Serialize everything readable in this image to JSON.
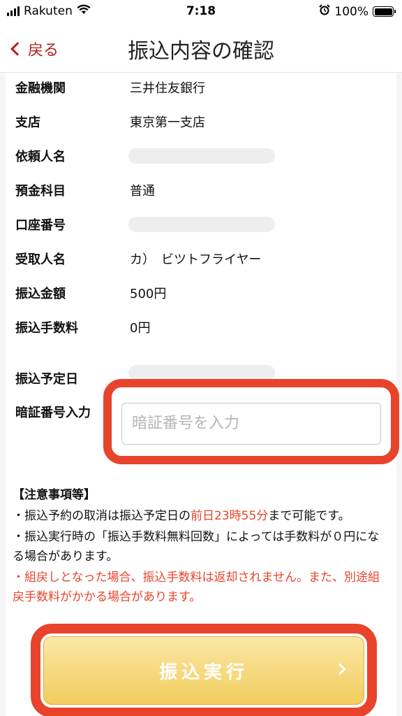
{
  "status_bar": {
    "carrier": "Rakuten",
    "time": "7:18",
    "battery": "100%"
  },
  "nav": {
    "back_label": "戻る",
    "title": "振込内容の確認"
  },
  "details": [
    {
      "label": "金融機関",
      "value": "三井住友銀行"
    },
    {
      "label": "支店",
      "value": "東京第一支店"
    },
    {
      "label": "依頼人名",
      "value": ""
    },
    {
      "label": "預金科目",
      "value": "普通"
    },
    {
      "label": "口座番号",
      "value": ""
    },
    {
      "label": "受取人名",
      "value": "カ）　ビツトフライヤー"
    },
    {
      "label": "振込金額",
      "value": "500円"
    },
    {
      "label": "振込手数料",
      "value": "0円"
    }
  ],
  "schedule_label": "振込予定日",
  "pin": {
    "label": "暗証番号入力",
    "placeholder": "暗証番号を入力"
  },
  "notes": {
    "heading": "【注意事項等】",
    "line1_before": "・振込予約の取消は振込予定日の",
    "line1_red": "前日23時55分",
    "line1_after": "まで可能です。",
    "line2": "・振込実行時の「振込手数料無料回数」によっては手数料が０円になる場合があります。",
    "line3": "・組戻しとなった場合、振込手数料は返却されません。また、別途組戻手数料がかかる場合があります。"
  },
  "execute_button": "振込実行",
  "colors": {
    "accent_red": "#b0241b",
    "highlight": "#e8442b",
    "button_gold": "#f2cc5d"
  }
}
